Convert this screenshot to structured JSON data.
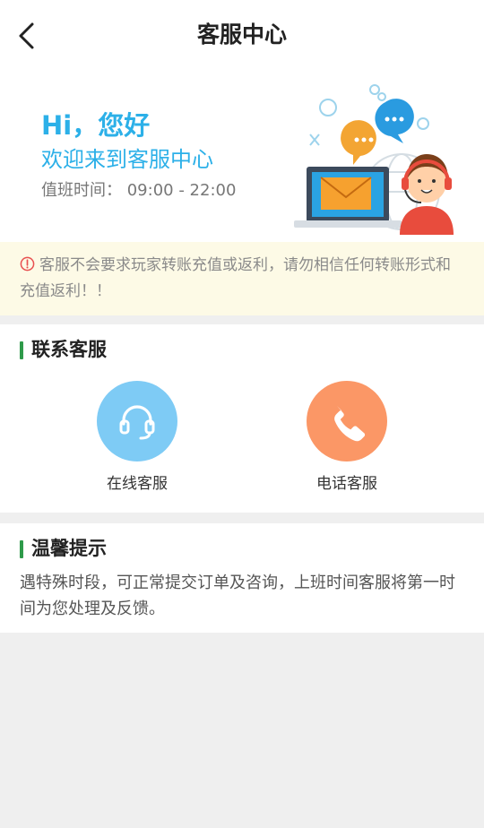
{
  "nav": {
    "title": "客服中心",
    "back_icon": "chevron-left-icon"
  },
  "hero": {
    "greeting": "Hi，您好",
    "welcome": "欢迎来到客服中心",
    "hours_label": "值班时间：",
    "hours": "09:00 - 22:00",
    "illustration": "customer-service-illustration",
    "accent_color": "#2cb0e8"
  },
  "warning": {
    "icon": "alert-circle-icon",
    "text": "客服不会要求玩家转账充值或返利，请勿相信任何转账形式和充值返利！！",
    "background": "#fdfae6",
    "icon_color": "#e85050"
  },
  "contact": {
    "title": "联系客服",
    "items": [
      {
        "label": "在线客服",
        "icon": "headset-icon",
        "color": "#7ecbf5"
      },
      {
        "label": "电话客服",
        "icon": "phone-icon",
        "color": "#fb9766"
      }
    ]
  },
  "tips": {
    "title": "温馨提示",
    "text": "遇特殊时段，可正常提交订单及咨询，上班时间客服将第一时间为您处理及反馈。"
  },
  "colors": {
    "section_bar": "#2e9a4a",
    "page_background": "#efefef"
  }
}
